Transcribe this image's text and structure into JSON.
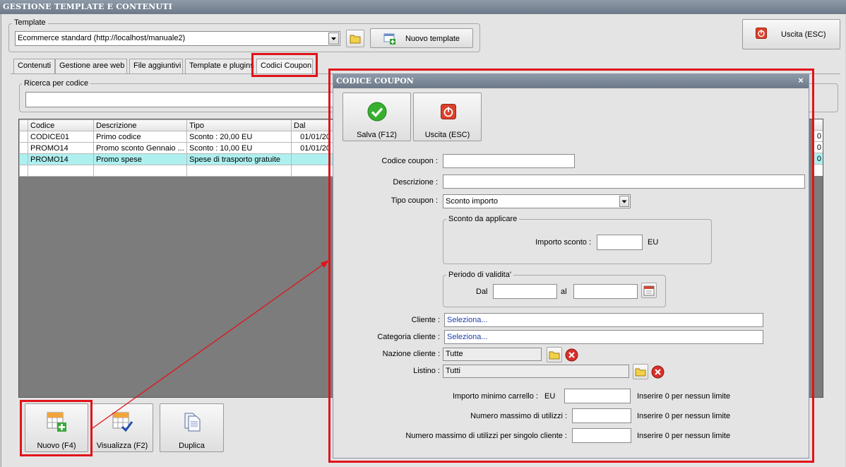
{
  "window": {
    "title": "GESTIONE TEMPLATE E CONTENUTI"
  },
  "template": {
    "group_label": "Template",
    "selected": "Ecommerce standard (http://localhost/manuale2)",
    "new_button": "Nuovo template",
    "exit_button": "Uscita (ESC)"
  },
  "tabs": [
    {
      "label": "Contenuti"
    },
    {
      "label": "Gestione aree web"
    },
    {
      "label": "File aggiuntivi"
    },
    {
      "label": "Template e plugins"
    },
    {
      "label": "Codici Coupon"
    }
  ],
  "search": {
    "group_label": "Ricerca per codice",
    "value": ""
  },
  "grid": {
    "columns": [
      "Codice",
      "Descrizione",
      "Tipo",
      "Dal"
    ],
    "rows": [
      {
        "codice": "CODICE01",
        "descrizione": "Primo codice",
        "tipo": "Sconto : 20,00 EU",
        "dal": "01/01/20",
        "last": "0"
      },
      {
        "codice": "PROMO14",
        "descrizione": "Promo sconto Gennaio ...",
        "tipo": "Sconto : 10,00 EU",
        "dal": "01/01/20",
        "last": "0"
      },
      {
        "codice": "PROMO14",
        "descrizione": "Promo spese",
        "tipo": "Spese di trasporto gratuite",
        "dal": "",
        "last": "0"
      }
    ]
  },
  "bottom_buttons": {
    "new": "Nuovo (F4)",
    "view": "Visualizza (F2)",
    "duplicate": "Duplica"
  },
  "dialog": {
    "title": "CODICE COUPON",
    "save_button": "Salva (F12)",
    "exit_button": "Uscita (ESC)",
    "codice_label": "Codice coupon :",
    "codice_value": "",
    "descrizione_label": "Descrizione :",
    "descrizione_value": "",
    "tipo_label": "Tipo coupon :",
    "tipo_value": "Sconto importo",
    "sconto_group": "Sconto da applicare",
    "importo_label": "Importo sconto :",
    "importo_value": "",
    "importo_unit": "EU",
    "periodo_group": "Periodo di validita'",
    "dal_label": "Dal",
    "dal_value": "",
    "al_label": "al",
    "al_value": "",
    "cliente_label": "Cliente :",
    "cliente_value": "Seleziona...",
    "categoria_label": "Categoria cliente :",
    "categoria_value": "Seleziona...",
    "nazione_label": "Nazione cliente :",
    "nazione_value": "Tutte",
    "listino_label": "Listino :",
    "listino_value": "Tutti",
    "min_carrello_label": "Importo minimo carrello :",
    "min_carrello_unit": "EU",
    "min_carrello_value": "",
    "max_utilizzi_label": "Numero massimo di utilizzi :",
    "max_utilizzi_value": "",
    "max_cliente_label": "Numero massimo di utilizzi per singolo cliente :",
    "max_cliente_value": "",
    "hint": "Inserire 0 per nessun limite"
  },
  "colors": {
    "highlight": "#e1131a",
    "selected_row": "#aef0f0",
    "titlebar": "#7a8696",
    "link_text": "#1a3fb0"
  }
}
